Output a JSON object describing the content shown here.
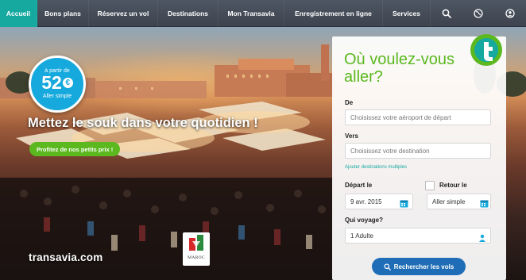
{
  "nav": {
    "items": [
      {
        "label": "Accueil",
        "active": true
      },
      {
        "label": "Bons plans",
        "active": false
      },
      {
        "label": "Réservez un vol",
        "active": false
      },
      {
        "label": "Destinations",
        "active": false
      },
      {
        "label": "Mon Transavia",
        "active": false
      },
      {
        "label": "Enregistrement en ligne",
        "active": false
      },
      {
        "label": "Services",
        "active": false
      }
    ],
    "icons": [
      "search-icon",
      "globe-icon",
      "user-icon"
    ]
  },
  "hero": {
    "price_prefix": "à partir de",
    "price_amount": "52",
    "price_currency": "€",
    "price_suffix": "Aller simple",
    "title": "Mettez le souk dans votre quotidien !",
    "promo_button": "Profitez de nos petits prix !",
    "brand": "transavia.com",
    "partner_label": "MAROC"
  },
  "search": {
    "title": "Où voulez-vous aller?",
    "from_label": "De",
    "from_placeholder": "Choisissez votre aéroport de départ",
    "to_label": "Vers",
    "to_placeholder": "Choisissez votre destination",
    "multi_link": "Ajouter destinations multiples",
    "depart_label": "Départ le",
    "depart_value": "9 avr. 2015",
    "return_label": "Retour le",
    "return_value": "Aller simple",
    "who_label": "Qui voyage?",
    "who_value": "1 Adulte",
    "submit": "Rechercher les vols"
  },
  "colors": {
    "nav_bg": "#454c57",
    "nav_active": "#16a9a0",
    "brand_green": "#5bb81f",
    "badge_blue": "#16a9dd",
    "button_blue": "#1e6db6"
  }
}
